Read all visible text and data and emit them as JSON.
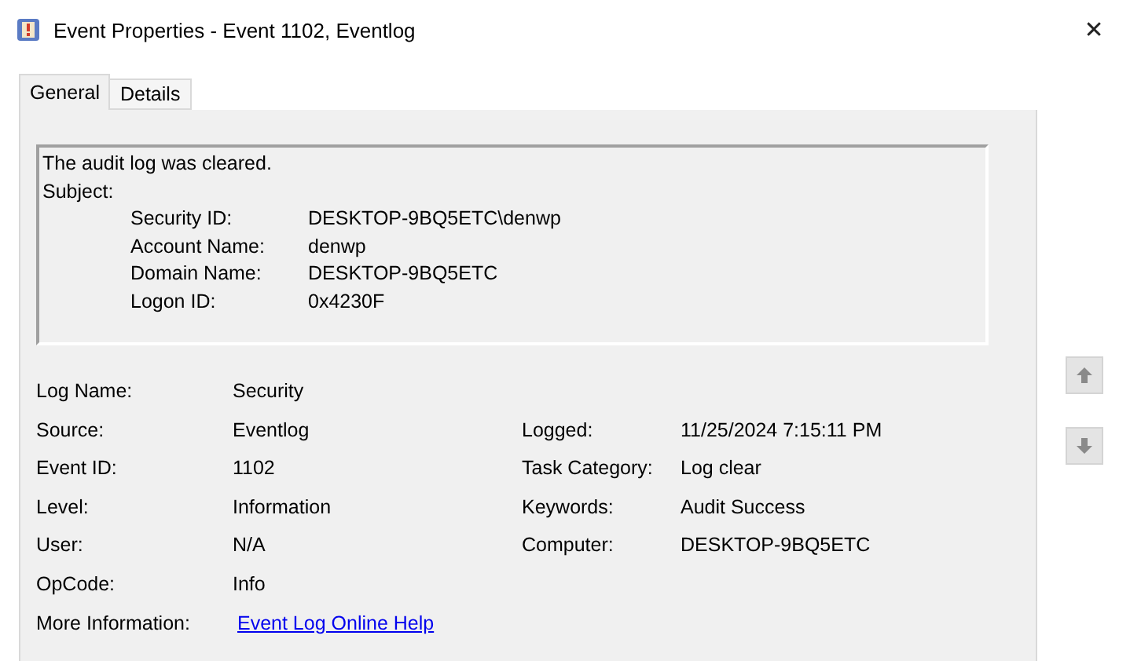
{
  "window": {
    "title": "Event Properties - Event 1102, Eventlog",
    "close": "✕"
  },
  "tabs": [
    {
      "label": "General",
      "selected": true
    },
    {
      "label": "Details",
      "selected": false
    }
  ],
  "description": {
    "message": "The audit log was cleared.",
    "subject": "Subject:",
    "fields": [
      {
        "label": "Security ID:",
        "value": "DESKTOP-9BQ5ETC\\denwp"
      },
      {
        "label": "Account Name:",
        "value": "denwp"
      },
      {
        "label": "Domain Name:",
        "value": "DESKTOP-9BQ5ETC"
      },
      {
        "label": "Logon ID:",
        "value": "0x4230F"
      }
    ]
  },
  "properties": [
    {
      "left": {
        "label": "Log Name:",
        "value": "Security"
      }
    },
    {
      "left": {
        "label": "Source:",
        "value": "Eventlog"
      },
      "right": {
        "label": "Logged:",
        "value": "11/25/2024 7:15:11 PM"
      }
    },
    {
      "left": {
        "label": "Event ID:",
        "value": "1102"
      },
      "right": {
        "label": "Task Category:",
        "value": "Log clear"
      }
    },
    {
      "left": {
        "label": "Level:",
        "value": "Information"
      },
      "right": {
        "label": "Keywords:",
        "value": "Audit Success"
      }
    },
    {
      "left": {
        "label": "User:",
        "value": "N/A"
      },
      "right": {
        "label": "Computer:",
        "value": "DESKTOP-9BQ5ETC"
      }
    },
    {
      "left": {
        "label": "OpCode:",
        "value": "Info"
      }
    }
  ],
  "more_information": {
    "label": "More Information:",
    "link": "Event Log Online Help"
  }
}
